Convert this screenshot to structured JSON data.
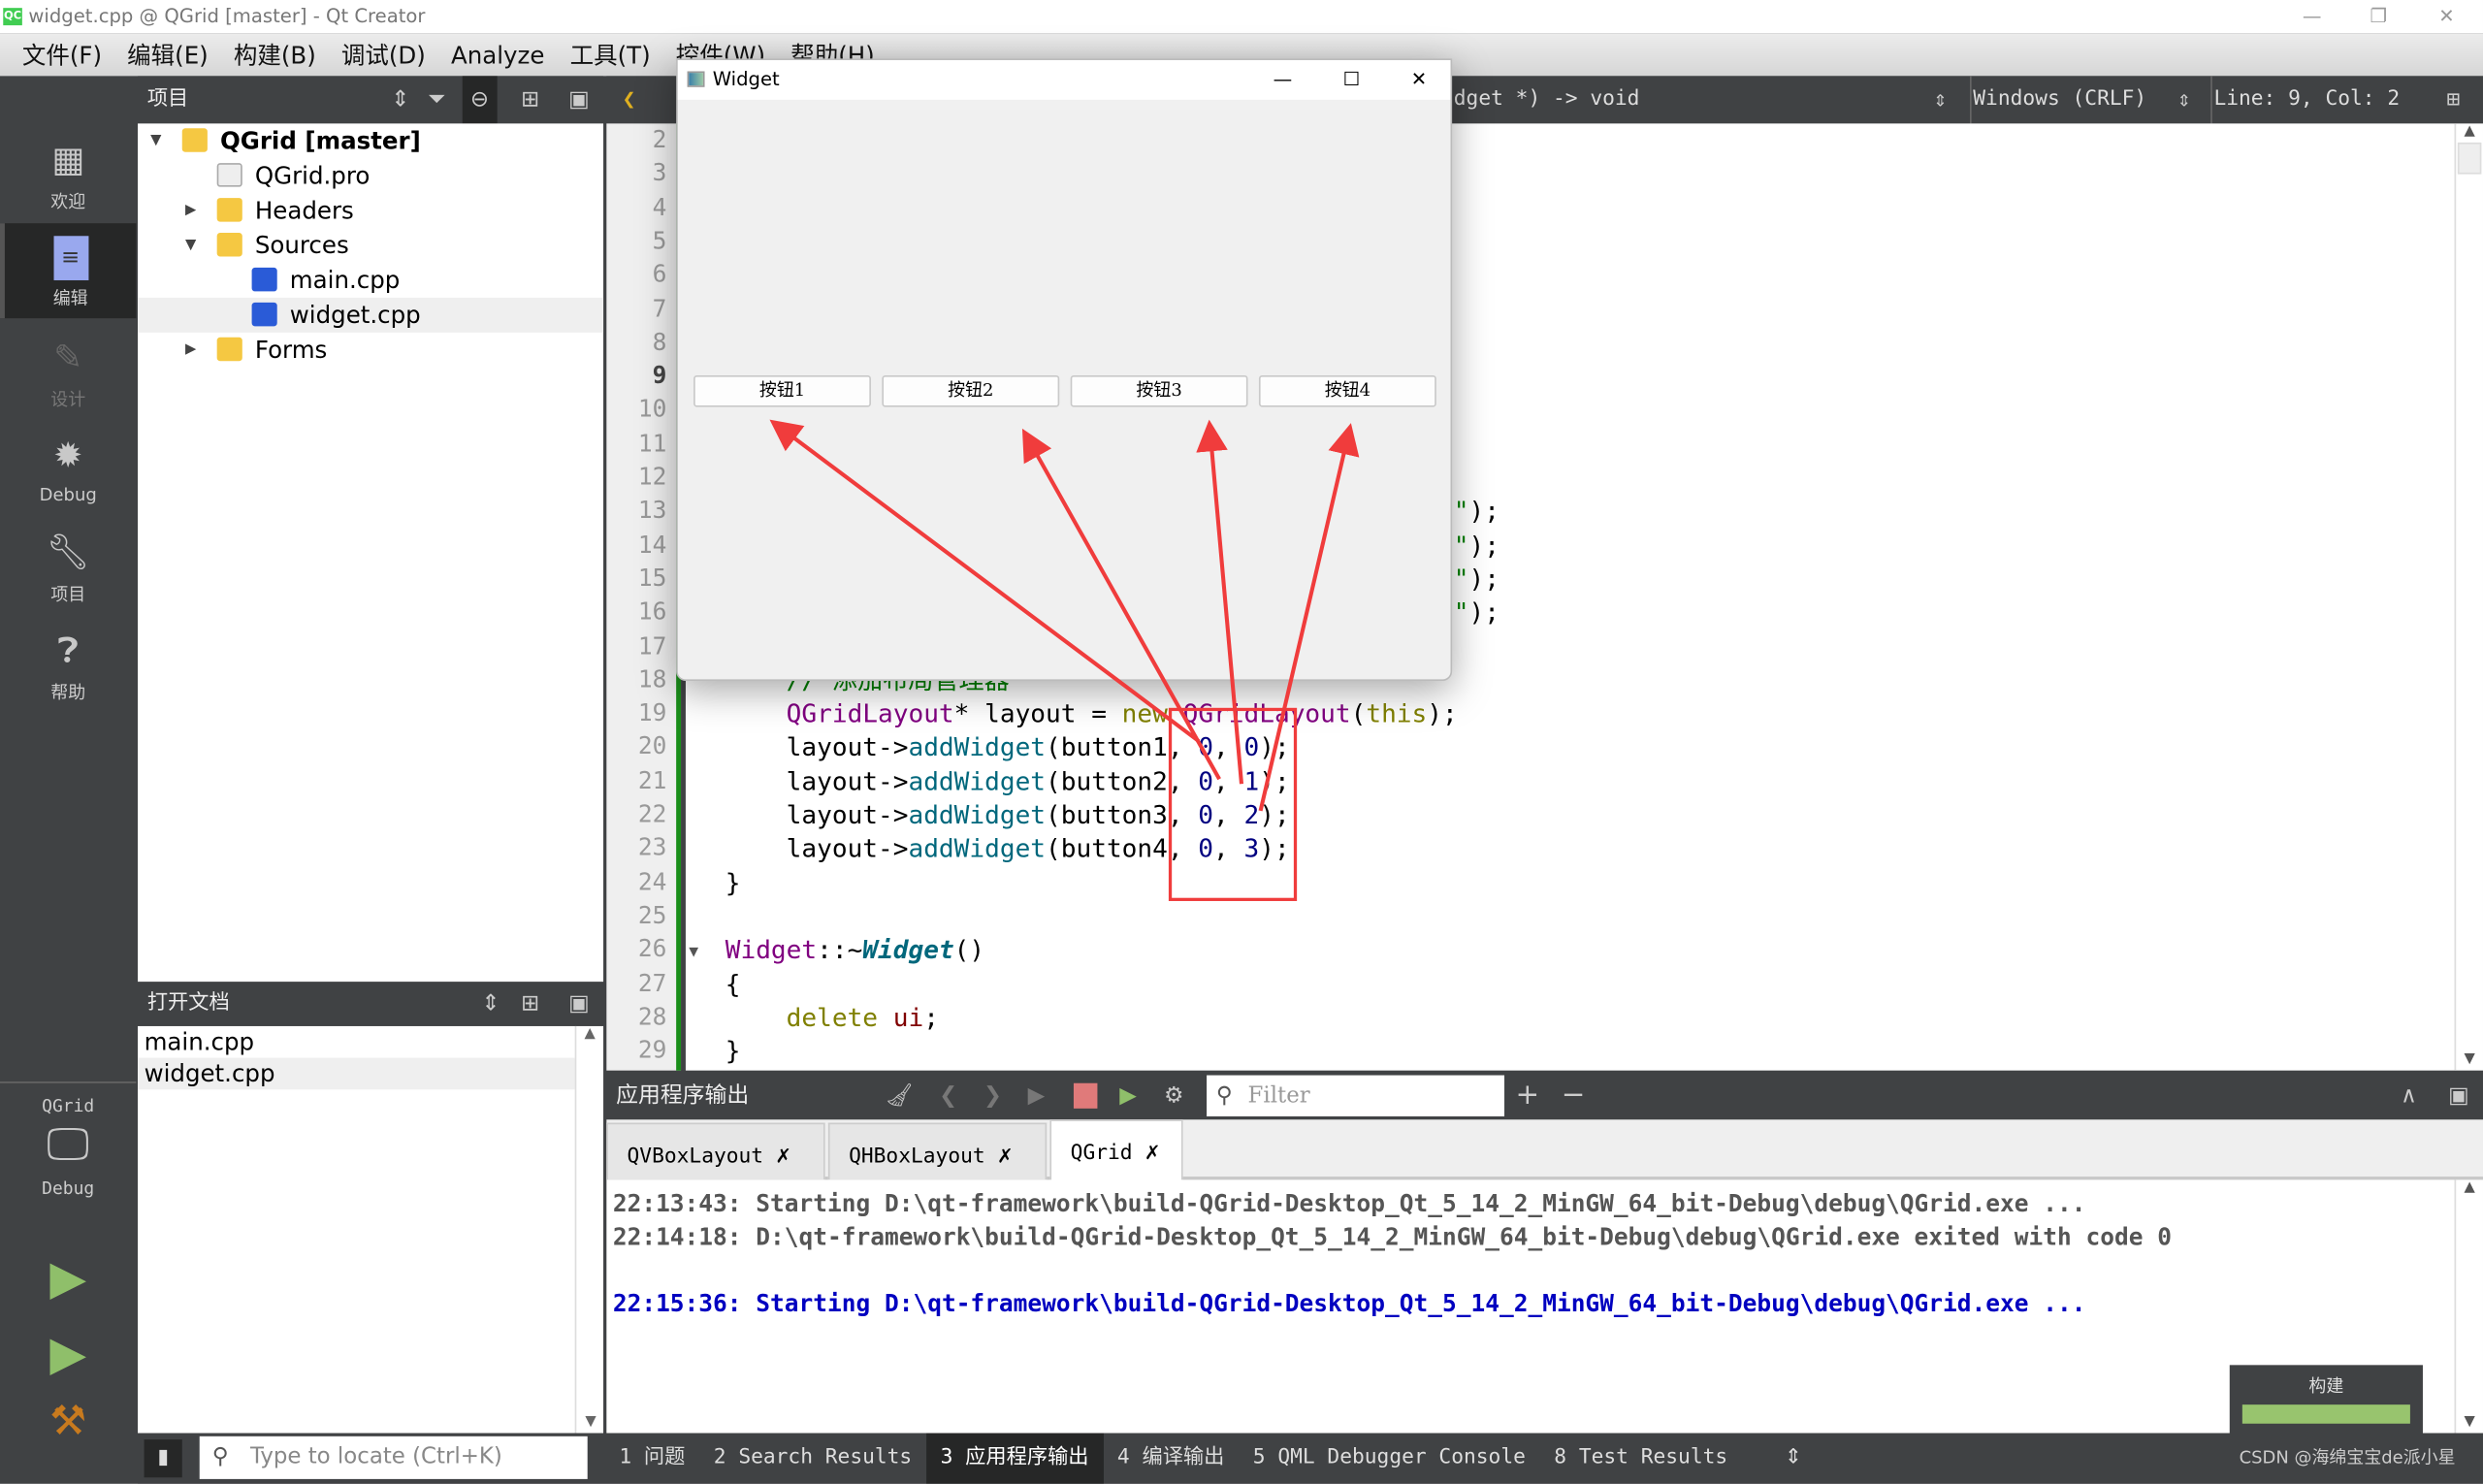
{
  "window": {
    "title": "widget.cpp @ QGrid [master] - Qt Creator",
    "app_icon": "QC"
  },
  "menu": [
    "文件(F)",
    "编辑(E)",
    "构建(B)",
    "调试(D)",
    "Analyze",
    "工具(T)",
    "控件(W)",
    "帮助(H)"
  ],
  "modes": [
    {
      "label": "欢迎",
      "icon": "grid-icon"
    },
    {
      "label": "编辑",
      "icon": "edit-icon",
      "active": true
    },
    {
      "label": "设计",
      "icon": "pencil-icon"
    },
    {
      "label": "Debug",
      "icon": "bug-icon"
    },
    {
      "label": "项目",
      "icon": "wrench-icon"
    },
    {
      "label": "帮助",
      "icon": "help-icon"
    }
  ],
  "kit": {
    "project": "QGrid",
    "config": "Debug"
  },
  "project_panel": {
    "title": "项目",
    "tree": [
      {
        "label": "QGrid [master]",
        "depth": 0,
        "expanded": true,
        "bold": true,
        "icon": "qt-project-folder"
      },
      {
        "label": "QGrid.pro",
        "depth": 1,
        "icon": "qt-pro-file"
      },
      {
        "label": "Headers",
        "depth": 1,
        "collapsed": true,
        "icon": "headers-folder"
      },
      {
        "label": "Sources",
        "depth": 1,
        "expanded": true,
        "icon": "sources-folder"
      },
      {
        "label": "main.cpp",
        "depth": 2,
        "icon": "cpp-file"
      },
      {
        "label": "widget.cpp",
        "depth": 2,
        "icon": "cpp-file",
        "selected": true
      },
      {
        "label": "Forms",
        "depth": 1,
        "collapsed": true,
        "icon": "forms-folder"
      }
    ]
  },
  "open_docs": {
    "title": "打开文档",
    "items": [
      "main.cpp",
      "widget.cpp"
    ],
    "selected": "widget.cpp"
  },
  "editor": {
    "symbol": "dget *) -> void",
    "line_ending": "Windows (CRLF)",
    "position": "Line: 9, Col: 2",
    "current_line": 9,
    "line_numbers": [
      2,
      3,
      4,
      5,
      6,
      7,
      8,
      9,
      10,
      11,
      12,
      13,
      14,
      15,
      16,
      17,
      18,
      19,
      20,
      21,
      22,
      23,
      24,
      25,
      26,
      27,
      28,
      29
    ],
    "lines": [
      {
        "n": 13,
        "frag": true,
        "tokens": [
          [
            "k-str",
            "\""
          ],
          [
            "",
            "); "
          ]
        ]
      },
      {
        "n": 14,
        "frag": true,
        "tokens": [
          [
            "k-str",
            "\""
          ],
          [
            "",
            "); "
          ]
        ]
      },
      {
        "n": 15,
        "frag": true,
        "tokens": [
          [
            "k-str",
            "\""
          ],
          [
            "",
            "); "
          ]
        ]
      },
      {
        "n": 16,
        "frag": true,
        "tokens": [
          [
            "k-str",
            "\""
          ],
          [
            "",
            "); "
          ]
        ]
      },
      {
        "n": 18,
        "tokens": [
          [
            "k-com",
            "    // 添加布局管理器"
          ]
        ]
      },
      {
        "n": 19,
        "tokens": [
          [
            "",
            "    "
          ],
          [
            "k-type",
            "QGridLayout"
          ],
          [
            "",
            "* layout = "
          ],
          [
            "k-kw",
            "new"
          ],
          [
            "k-type",
            " QGridLayout"
          ],
          [
            "",
            "("
          ],
          [
            "k-kw",
            "this"
          ],
          [
            "",
            ");"
          ]
        ]
      },
      {
        "n": 20,
        "tokens": [
          [
            "",
            "    layout->"
          ],
          [
            "k-fn",
            "addWidget"
          ],
          [
            "",
            "(button1, "
          ],
          [
            "k-num",
            "0"
          ],
          [
            "",
            ", "
          ],
          [
            "k-num",
            "0"
          ],
          [
            "",
            ");"
          ]
        ]
      },
      {
        "n": 21,
        "tokens": [
          [
            "",
            "    layout->"
          ],
          [
            "k-fn",
            "addWidget"
          ],
          [
            "",
            "(button2, "
          ],
          [
            "k-num",
            "0"
          ],
          [
            "",
            ", "
          ],
          [
            "k-num",
            "1"
          ],
          [
            "",
            ");"
          ]
        ]
      },
      {
        "n": 22,
        "tokens": [
          [
            "",
            "    layout->"
          ],
          [
            "k-fn",
            "addWidget"
          ],
          [
            "",
            "(button3, "
          ],
          [
            "k-num",
            "0"
          ],
          [
            "",
            ", "
          ],
          [
            "k-num",
            "2"
          ],
          [
            "",
            ");"
          ]
        ]
      },
      {
        "n": 23,
        "tokens": [
          [
            "",
            "    layout->"
          ],
          [
            "k-fn",
            "addWidget"
          ],
          [
            "",
            "(button4, "
          ],
          [
            "k-num",
            "0"
          ],
          [
            "",
            ", "
          ],
          [
            "k-num",
            "3"
          ],
          [
            "",
            ");"
          ]
        ]
      },
      {
        "n": 24,
        "tokens": [
          [
            "",
            "}"
          ]
        ]
      },
      {
        "n": 26,
        "tokens": [
          [
            "k-type",
            "Widget"
          ],
          [
            "",
            "::~"
          ],
          [
            "k-it",
            "Widget"
          ],
          [
            "",
            "()"
          ]
        ]
      },
      {
        "n": 27,
        "tokens": [
          [
            "",
            "{"
          ]
        ]
      },
      {
        "n": 28,
        "tokens": [
          [
            "",
            "    "
          ],
          [
            "k-kw",
            "delete"
          ],
          [
            "k-var",
            " ui"
          ],
          [
            "",
            ";"
          ]
        ]
      },
      {
        "n": 29,
        "tokens": [
          [
            "",
            "}"
          ]
        ]
      }
    ]
  },
  "output_pane": {
    "title": "应用程序输出",
    "filter_placeholder": "Filter",
    "tabs": [
      {
        "label": "QVBoxLayout"
      },
      {
        "label": "QHBoxLayout"
      },
      {
        "label": "QGrid",
        "selected": true
      }
    ],
    "lines": [
      {
        "text": "22:13:43: Starting D:\\qt-framework\\build-QGrid-Desktop_Qt_5_14_2_MinGW_64_bit-Debug\\debug\\QGrid.exe ...",
        "color": "#555555"
      },
      {
        "text": "22:14:18: D:\\qt-framework\\build-QGrid-Desktop_Qt_5_14_2_MinGW_64_bit-Debug\\debug\\QGrid.exe exited with code 0",
        "color": "#555555"
      },
      {
        "text": "22:15:36: Starting D:\\qt-framework\\build-QGrid-Desktop_Qt_5_14_2_MinGW_64_bit-Debug\\debug\\QGrid.exe ...",
        "color": "#0000c0"
      }
    ]
  },
  "build_progress": {
    "label": "构建",
    "value": 100,
    "color": "#98c46e"
  },
  "statusbar": {
    "locate_placeholder": "Type to locate (Ctrl+K)",
    "panes": [
      "1 问题",
      "2 Search Results",
      "3 应用程序输出",
      "4 编译输出",
      "5 QML Debugger Console",
      "8 Test Results"
    ],
    "active": "3 应用程序输出",
    "watermark": "CSDN @海绵宝宝de派小星"
  },
  "widget_window": {
    "title": "Widget",
    "buttons": [
      "按钮1",
      "按钮2",
      "按钮3",
      "按钮4"
    ]
  },
  "annotation": {
    "color": "#f03c3c"
  }
}
